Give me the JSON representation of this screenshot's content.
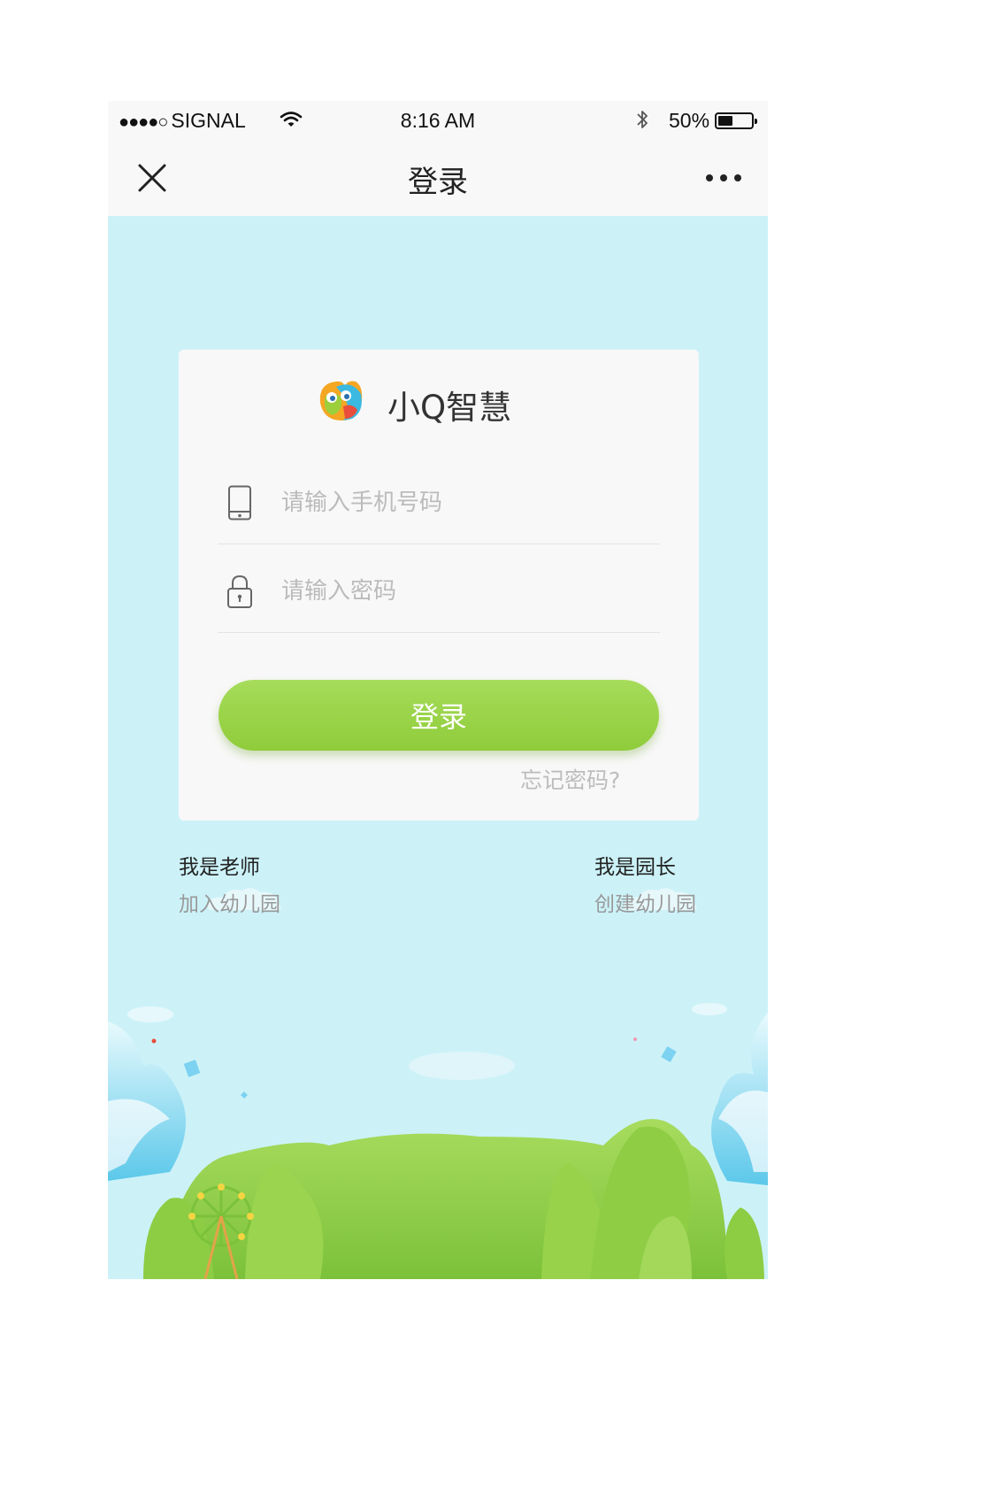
{
  "status_bar": {
    "signal_dots": "●●●●○",
    "carrier": "SIGNAL",
    "time": "8:16 AM",
    "battery": "50%",
    "battery_level": 0.5
  },
  "nav": {
    "title": "登录",
    "close_icon": "close-icon",
    "more_icon": "more-icon"
  },
  "brand": {
    "name": "小Q智慧",
    "logo_icon": "owl-logo-icon"
  },
  "form": {
    "phone_placeholder": "请输入手机号码",
    "phone_value": "",
    "phone_icon": "mobile-phone-icon",
    "password_placeholder": "请输入密码",
    "password_value": "",
    "password_icon": "lock-icon",
    "login_label": "登录",
    "forgot_label": "忘记密码?"
  },
  "roles": [
    {
      "title": "我是老师",
      "subtitle": "加入幼儿园"
    },
    {
      "title": "我是园长",
      "subtitle": "创建幼儿园"
    }
  ],
  "colors": {
    "background": "#ccf2f8",
    "accent_green": "#98d14a",
    "card": "#f8f8f8"
  }
}
